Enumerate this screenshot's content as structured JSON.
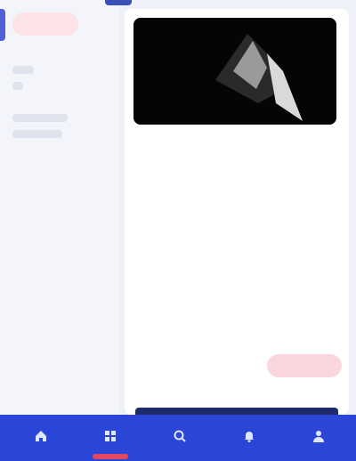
{
  "app": {
    "brand": ""
  },
  "card": {
    "title": "",
    "rows": [
      {
        "label": "",
        "value": ""
      },
      {
        "label": "",
        "value": ""
      },
      {
        "label": "",
        "value": ""
      },
      {
        "label": "",
        "value": ""
      },
      {
        "label": "",
        "value": ""
      },
      {
        "label": "",
        "value": ""
      }
    ],
    "action_label": ""
  },
  "bottom_nav": [
    {
      "label": "",
      "icon": "home-icon"
    },
    {
      "label": "",
      "icon": "grid-icon"
    },
    {
      "label": "",
      "icon": "search-icon"
    },
    {
      "label": "",
      "icon": "bell-icon"
    },
    {
      "label": "",
      "icon": "user-icon"
    }
  ],
  "colors": {
    "accent": "#2b46d6",
    "brand": "#d84d66"
  }
}
